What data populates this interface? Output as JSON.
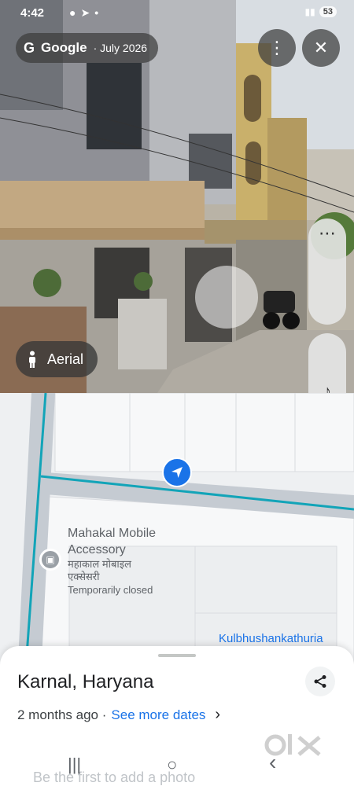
{
  "status_bar": {
    "time": "4:42",
    "battery": "53"
  },
  "header": {
    "brand": "Google",
    "date": "· July 2026"
  },
  "buttons": {
    "more_icon": "⋮",
    "close_icon": "✕",
    "aerial_label": "Aerial",
    "side_more_icon": "⋯",
    "audio_icon": "♪"
  },
  "map": {
    "place_name_line1": "Mahakal Mobile",
    "place_name_line2": "Accessory",
    "place_hindi_line1": "महाकाल मोबाइल",
    "place_hindi_line2": "एक्सेसरी",
    "place_status": "Temporarily closed",
    "street_label": "Kulbhushankathuria"
  },
  "sheet": {
    "location": "Karnal, Haryana",
    "time_ago": "2 months ago ·",
    "see_more": "See more dates",
    "chevron": "›",
    "first_photo": "Be the first to add a photo"
  },
  "navbar": {
    "recent": "|||",
    "home": "○",
    "back": "‹"
  },
  "watermark": "olx",
  "colors": {
    "accent": "#1a73e8",
    "road_highlight": "#12a4b8"
  }
}
